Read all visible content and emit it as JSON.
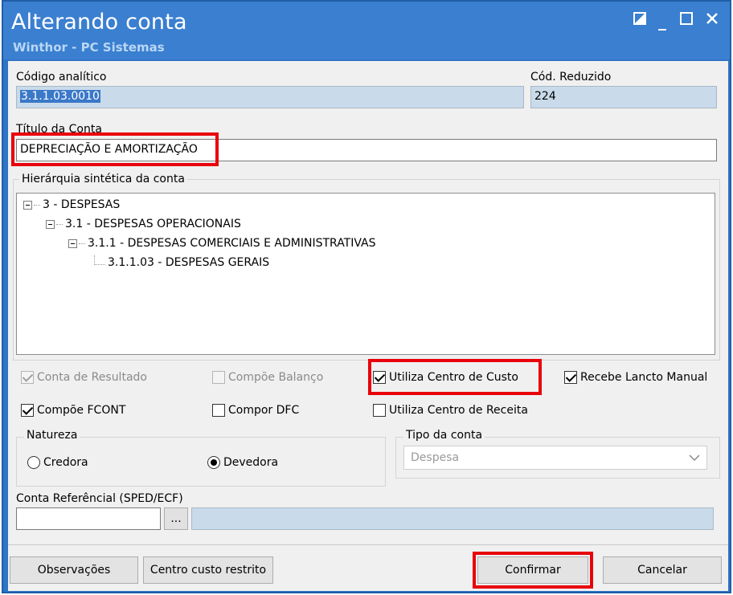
{
  "window": {
    "title": "Alterando conta",
    "subtitle": "Winthor - PC Sistemas"
  },
  "fields": {
    "codigo_analitico_label": "Código analítico",
    "codigo_analitico_value": "3.1.1.03.0010",
    "cod_reduzido_label": "Cód. Reduzido",
    "cod_reduzido_value": "224",
    "titulo_label": "Título da Conta",
    "titulo_value": "DEPRECIAÇÃO E AMORTIZAÇÃO"
  },
  "hierarchy": {
    "title": "Hierárquia sintética da conta",
    "nodes": [
      "3 - DESPESAS",
      "3.1 - DESPESAS OPERACIONAIS",
      "3.1.1 - DESPESAS COMERCIAIS E ADMINISTRATIVAS",
      "3.1.1.03 - DESPESAS GERAIS"
    ]
  },
  "checkboxes": {
    "conta_resultado": {
      "label": "Conta de Resultado",
      "checked": true,
      "enabled": false
    },
    "compoe_balanco": {
      "label": "Compõe Balanço",
      "checked": false,
      "enabled": false
    },
    "utiliza_centro_custo": {
      "label": "Utiliza Centro de Custo",
      "checked": true,
      "enabled": true
    },
    "recebe_lancto_manual": {
      "label": "Recebe Lancto Manual",
      "checked": true,
      "enabled": true
    },
    "compoe_fcont": {
      "label": "Compõe FCONT",
      "checked": true,
      "enabled": true
    },
    "compor_dfc": {
      "label": "Compor DFC",
      "checked": false,
      "enabled": true
    },
    "utiliza_centro_receita": {
      "label": "Utiliza Centro de Receita",
      "checked": false,
      "enabled": true
    }
  },
  "natureza": {
    "title": "Natureza",
    "options": [
      "Credora",
      "Devedora"
    ],
    "selected": "Devedora"
  },
  "tipo_conta": {
    "title": "Tipo da conta",
    "value": "Despesa"
  },
  "conta_referencial": {
    "label": "Conta Referêncial (SPED/ECF)",
    "browse": "..."
  },
  "buttons": {
    "observacoes": "Observações",
    "centro_custo_restrito": "Centro custo restrito",
    "confirmar": "Confirmar",
    "cancelar": "Cancelar"
  },
  "colors": {
    "titlebar": "#3a7fd0",
    "highlight": "#e8000b",
    "readonly_field": "#c9dbea"
  }
}
